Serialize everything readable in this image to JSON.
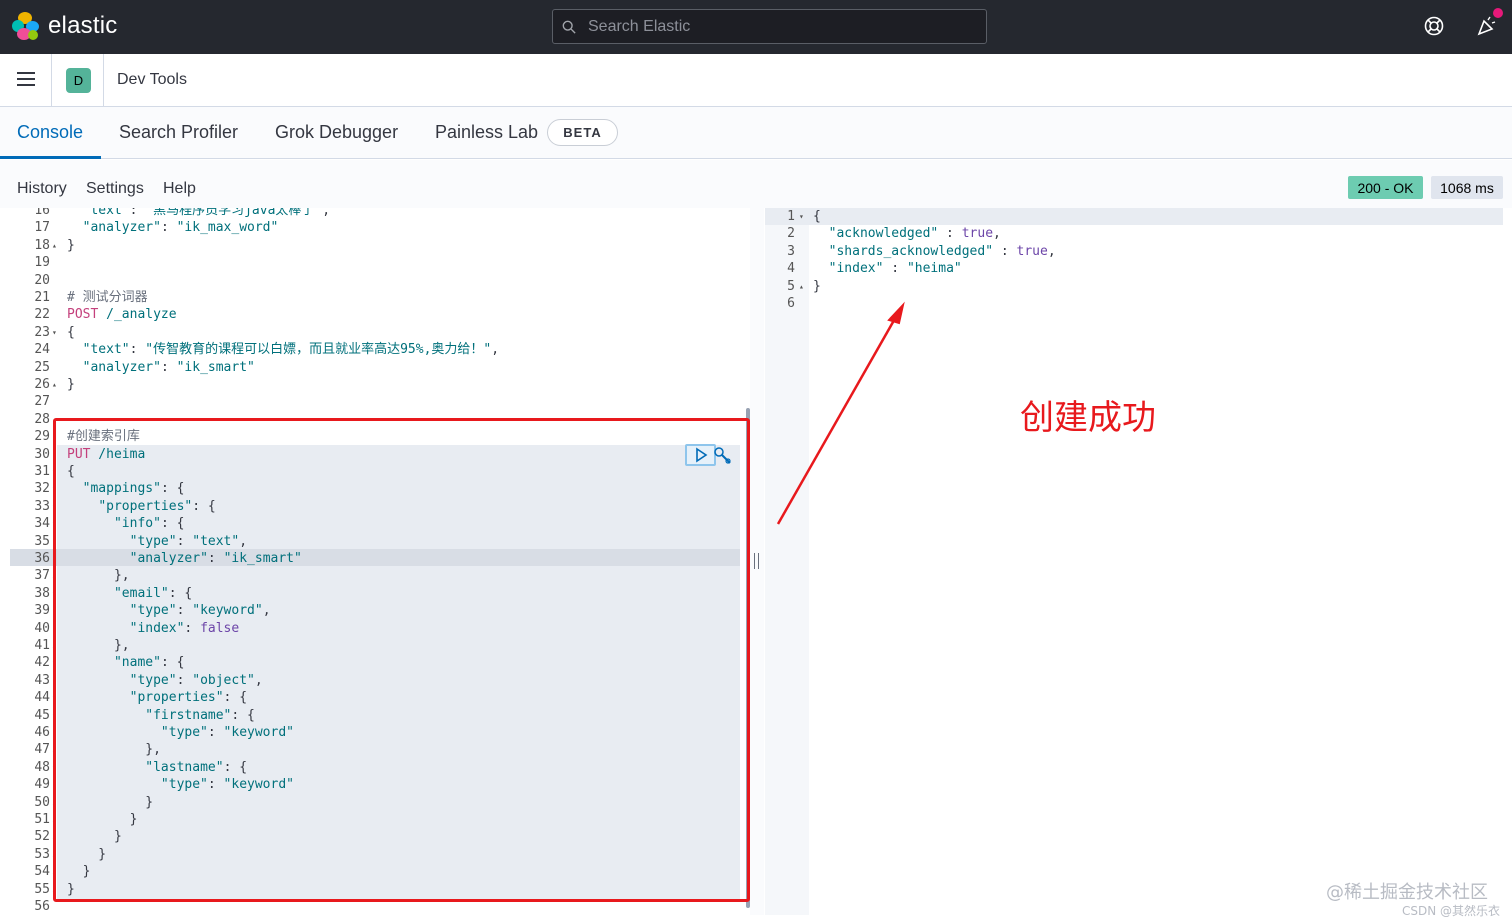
{
  "header": {
    "brand": "elastic",
    "search_placeholder": "Search Elastic",
    "icons": [
      "elastic-logo-icon",
      "search-icon",
      "help-icon",
      "news-feed-icon"
    ],
    "notification_color": "#e6197a"
  },
  "appbar": {
    "app_badge": "D",
    "app_title": "Dev Tools"
  },
  "tabs": {
    "items": [
      {
        "label": "Console",
        "active": true
      },
      {
        "label": "Search Profiler",
        "active": false
      },
      {
        "label": "Grok Debugger",
        "active": false
      },
      {
        "label": "Painless Lab",
        "active": false
      }
    ],
    "beta_label": "BETA",
    "accent_color": "#006bb8"
  },
  "subnav": {
    "history": "History",
    "settings": "Settings",
    "help": "Help",
    "status": "200 - OK",
    "time": "1068 ms"
  },
  "editor": {
    "lines": [
      {
        "n": "16",
        "fold": "",
        "t": "  \"text\": \"黑马程序员学习java太棒了\","
      },
      {
        "n": "17",
        "fold": "",
        "t": "  \"analyzer\": \"ik_max_word\""
      },
      {
        "n": "18",
        "fold": "▴",
        "t": "}"
      },
      {
        "n": "19",
        "fold": "",
        "t": ""
      },
      {
        "n": "20",
        "fold": "",
        "t": ""
      },
      {
        "n": "21",
        "fold": "",
        "t": "# 测试分词器"
      },
      {
        "n": "22",
        "fold": "",
        "t": "POST /_analyze"
      },
      {
        "n": "23",
        "fold": "▾",
        "t": "{"
      },
      {
        "n": "24",
        "fold": "",
        "t": "  \"text\": \"传智教育的课程可以白嫖，而且就业率高达95%,奥力给！\","
      },
      {
        "n": "25",
        "fold": "",
        "t": "  \"analyzer\": \"ik_smart\""
      },
      {
        "n": "26",
        "fold": "▴",
        "t": "}"
      },
      {
        "n": "27",
        "fold": "",
        "t": ""
      },
      {
        "n": "28",
        "fold": "",
        "t": ""
      },
      {
        "n": "29",
        "fold": "",
        "t": "#创建索引库"
      },
      {
        "n": "30",
        "fold": "",
        "t": "PUT /heima"
      },
      {
        "n": "31",
        "fold": "▾",
        "t": "{"
      },
      {
        "n": "32",
        "fold": "▾",
        "t": "  \"mappings\": {"
      },
      {
        "n": "33",
        "fold": "▾",
        "t": "    \"properties\": {"
      },
      {
        "n": "34",
        "fold": "▾",
        "t": "      \"info\": {"
      },
      {
        "n": "35",
        "fold": "",
        "t": "        \"type\": \"text\","
      },
      {
        "n": "36",
        "fold": "",
        "t": "        \"analyzer\": \"ik_smart\""
      },
      {
        "n": "37",
        "fold": "▴",
        "t": "      },"
      },
      {
        "n": "38",
        "fold": "▾",
        "t": "      \"email\": {"
      },
      {
        "n": "39",
        "fold": "",
        "t": "        \"type\": \"keyword\","
      },
      {
        "n": "40",
        "fold": "",
        "t": "        \"index\": false"
      },
      {
        "n": "41",
        "fold": "▴",
        "t": "      },"
      },
      {
        "n": "42",
        "fold": "▾",
        "t": "      \"name\": {"
      },
      {
        "n": "43",
        "fold": "",
        "t": "        \"type\": \"object\","
      },
      {
        "n": "44",
        "fold": "▾",
        "t": "        \"properties\": {"
      },
      {
        "n": "45",
        "fold": "▾",
        "t": "          \"firstname\": {"
      },
      {
        "n": "46",
        "fold": "",
        "t": "            \"type\": \"keyword\""
      },
      {
        "n": "47",
        "fold": "▴",
        "t": "          },"
      },
      {
        "n": "48",
        "fold": "▾",
        "t": "          \"lastname\": {"
      },
      {
        "n": "49",
        "fold": "",
        "t": "            \"type\": \"keyword\""
      },
      {
        "n": "50",
        "fold": "▴",
        "t": "          }"
      },
      {
        "n": "51",
        "fold": "▴",
        "t": "        }"
      },
      {
        "n": "52",
        "fold": "▴",
        "t": "      }"
      },
      {
        "n": "53",
        "fold": "▴",
        "t": "    }"
      },
      {
        "n": "54",
        "fold": "▴",
        "t": "  }"
      },
      {
        "n": "55",
        "fold": "▴",
        "t": "}"
      },
      {
        "n": "56",
        "fold": "",
        "t": ""
      }
    ]
  },
  "output": {
    "lines": [
      {
        "n": "1",
        "fold": "▾",
        "t": "{"
      },
      {
        "n": "2",
        "fold": "",
        "t": "  \"acknowledged\" : true,"
      },
      {
        "n": "3",
        "fold": "",
        "t": "  \"shards_acknowledged\" : true,"
      },
      {
        "n": "4",
        "fold": "",
        "t": "  \"index\" : \"heima\""
      },
      {
        "n": "5",
        "fold": "▴",
        "t": "}"
      },
      {
        "n": "6",
        "fold": "",
        "t": ""
      }
    ]
  },
  "annotation": {
    "text": "创建成功",
    "color": "#e8191d"
  },
  "watermark": {
    "line1": "@稀土掘金技术社区",
    "line2": "CSDN @其然乐衣"
  }
}
